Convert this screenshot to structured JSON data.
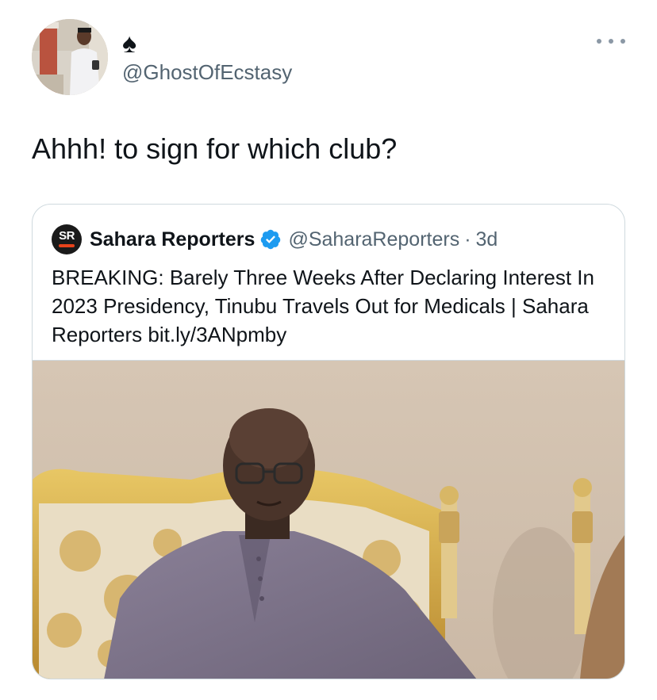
{
  "tweet": {
    "display_name": "♠",
    "handle": "@GhostOfEcstasy",
    "text": "Ahhh! to sign for which club?",
    "more_icon": "more-horizontal-icon"
  },
  "quoted_tweet": {
    "logo_text": "SR",
    "name": "Sahara Reporters",
    "verified_icon": "verified-badge-icon",
    "handle": "@SaharaReporters",
    "separator": "·",
    "time": "3d",
    "text": "BREAKING: Barely Three Weeks After Declaring Interest In 2023 Presidency, Tinubu Travels Out for Medicals | Sahara Reporters bit.ly/3ANpmby"
  },
  "colors": {
    "text_primary": "#0f1419",
    "text_secondary": "#536471",
    "border": "#cfd9de",
    "verified": "#1d9bf0",
    "sr_accent": "#e8431b"
  }
}
